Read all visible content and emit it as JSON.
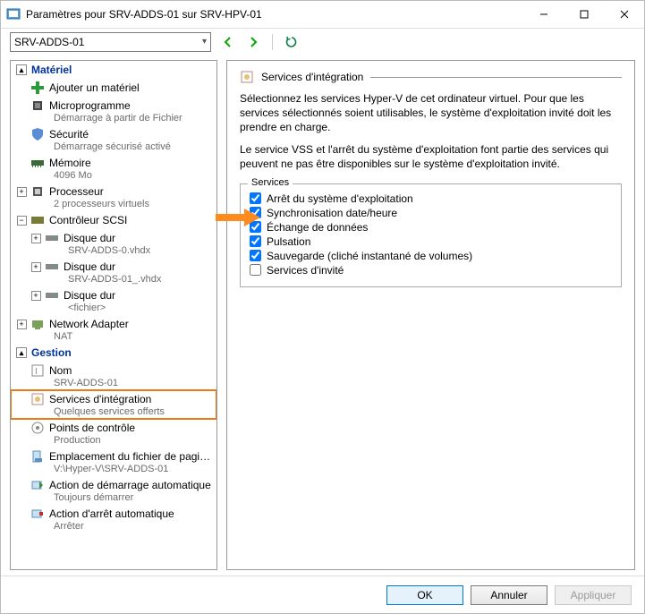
{
  "window": {
    "title": "Paramètres pour SRV-ADDS-01 sur SRV-HPV-01"
  },
  "toolbar": {
    "vm_combo": "SRV-ADDS-01"
  },
  "sections": {
    "hardware": "Matériel",
    "management": "Gestion"
  },
  "tree": {
    "add_hw": "Ajouter un matériel",
    "firmware": "Microprogramme",
    "firmware_sub": "Démarrage à partir de Fichier",
    "security": "Sécurité",
    "security_sub": "Démarrage sécurisé activé",
    "memory": "Mémoire",
    "memory_sub": "4096 Mo",
    "cpu": "Processeur",
    "cpu_sub": "2 processeurs virtuels",
    "scsi": "Contrôleur SCSI",
    "disk1": "Disque dur",
    "disk1_sub": "SRV-ADDS-0.vhdx",
    "disk2": "Disque dur",
    "disk2_sub": "SRV-ADDS-01_.vhdx",
    "disk3": "Disque dur",
    "disk3_sub": "<fichier>",
    "nic": "Network Adapter",
    "nic_sub": "NAT",
    "name": "Nom",
    "name_sub": "SRV-ADDS-01",
    "integ": "Services d'intégration",
    "integ_sub": "Quelques services offerts",
    "chk": "Points de contrôle",
    "chk_sub": "Production",
    "paging": "Emplacement du fichier de paginati...",
    "paging_sub": "V:\\Hyper-V\\SRV-ADDS-01",
    "autostart": "Action de démarrage automatique",
    "autostart_sub": "Toujours démarrer",
    "autostop": "Action d'arrêt automatique",
    "autostop_sub": "Arrêter"
  },
  "panel": {
    "heading": "Services d'intégration",
    "desc1": "Sélectionnez les services Hyper-V de cet ordinateur virtuel. Pour que les services sélectionnés soient utilisables, le système d'exploitation invité doit les prendre en charge.",
    "desc2": "Le service VSS et l'arrêt du système d'exploitation font partie des services qui peuvent ne pas être disponibles sur le système d'exploitation invité.",
    "services_legend": "Services",
    "svc": [
      {
        "label": "Arrêt du système d'exploitation",
        "checked": true
      },
      {
        "label": "Synchronisation date/heure",
        "checked": true
      },
      {
        "label": "Échange de données",
        "checked": true
      },
      {
        "label": "Pulsation",
        "checked": true
      },
      {
        "label": "Sauvegarde (cliché instantané de volumes)",
        "checked": true
      },
      {
        "label": "Services d'invité",
        "checked": false
      }
    ]
  },
  "buttons": {
    "ok": "OK",
    "cancel": "Annuler",
    "apply": "Appliquer"
  }
}
